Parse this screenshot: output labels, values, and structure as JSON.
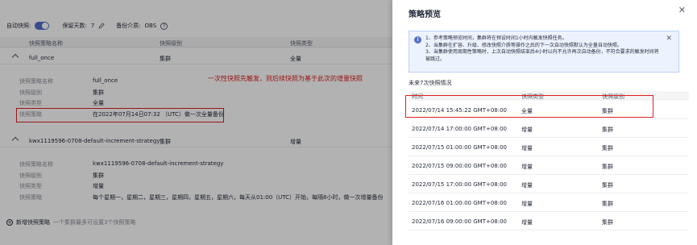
{
  "left": {
    "toolbar": {
      "auto_backup_label": "自动快照:",
      "retention_label": "保留天数:",
      "retention_value": "7",
      "edit_icon": "pencil-icon",
      "medium_label": "备份介质:",
      "medium_value": "OBS",
      "help_icon": "question-circle-icon"
    },
    "table_headers": [
      "快照策略名称",
      "快照级别",
      "快照类型"
    ],
    "groups": [
      {
        "name": "full_once",
        "level": "集群",
        "type": "全量",
        "details": [
          {
            "key": "快照策略名称",
            "value": "full_once"
          },
          {
            "key": "快照级别",
            "value": "集群"
          },
          {
            "key": "快照类型",
            "value": "全量"
          },
          {
            "key": "快照策略",
            "value": "在2022年07月14日07:32 （UTC）做一次全量备份"
          }
        ]
      },
      {
        "name": "kwx1119596-0708-default-increment-strategy",
        "level": "集群",
        "type": "增量",
        "details": [
          {
            "key": "快照策略名称",
            "value": "kwx1119596-0708-default-increment-strategy"
          },
          {
            "key": "快照级别",
            "value": "集群"
          },
          {
            "key": "快照类型",
            "value": "增量"
          },
          {
            "key": "快照策略",
            "value": "每个星期一，星期二，星期三，星期四，星期五，星期六，每天从01:00（UTC）开始，每隔8小时，做一次增量备份"
          }
        ]
      }
    ],
    "annotation": "一次性快照先触发，则后续快照为基于此次的增量快照",
    "add_label": "新增快照策略",
    "add_hint": "一个集群最多可设置3个快照策略"
  },
  "drawer": {
    "title": "策略预览",
    "info_lines": [
      "1、参考策略预览时间，集群将在预设时间1小时内触发快照任务。",
      "2、当集群在扩容、升级、修改快照介质等操作之后的下一次自动快照默认为全量自动快照。",
      "3、当集群使用周期性策略时，上次自动快照结束后4小时以内不允许再次自动备份，不符合要求的触发时间将被跳过。"
    ],
    "schedule_label": "未来7次快照情况",
    "schedule_headers": [
      "时间",
      "快照类型",
      "快照级别"
    ],
    "schedule": [
      {
        "time": "2022/07/14 15:45:22 GMT+08:00",
        "type": "全量",
        "level": "集群"
      },
      {
        "time": "2022/07/14 17:00:00 GMT+08:00",
        "type": "增量",
        "level": "集群"
      },
      {
        "time": "2022/07/15 01:00:00 GMT+08:00",
        "type": "增量",
        "level": "集群"
      },
      {
        "time": "2022/07/15 09:00:00 GMT+08:00",
        "type": "增量",
        "level": "集群"
      },
      {
        "time": "2022/07/15 17:00:00 GMT+08:00",
        "type": "增量",
        "level": "集群"
      },
      {
        "time": "2022/07/16 01:00:00 GMT+08:00",
        "type": "增量",
        "level": "集群"
      },
      {
        "time": "2022/07/16 09:00:00 GMT+08:00",
        "type": "增量",
        "level": "集群"
      }
    ],
    "close_icon": "close-icon",
    "info_icon": "info-icon"
  },
  "colors": {
    "accent": "#526ecc",
    "annotation": "#e02020",
    "info_bg": "#edf3fe"
  }
}
